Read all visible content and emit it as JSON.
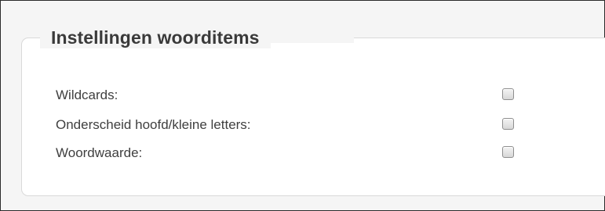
{
  "panel": {
    "title": "Instellingen woorditems"
  },
  "settings": [
    {
      "label": "Wildcards:",
      "checked": false
    },
    {
      "label": "Onderscheid hoofd/kleine letters:",
      "checked": false
    },
    {
      "label": "Woordwaarde:",
      "checked": false
    }
  ]
}
